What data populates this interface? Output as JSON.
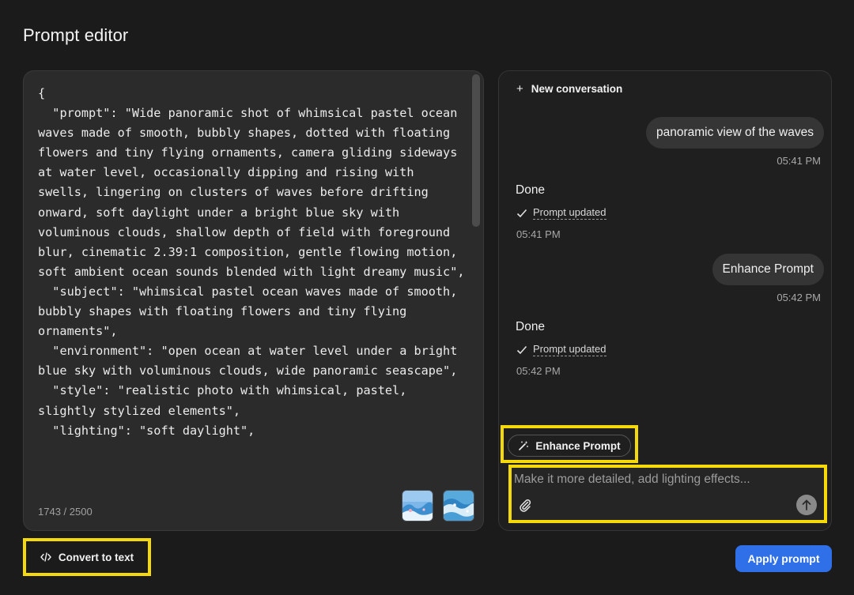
{
  "page": {
    "title": "Prompt editor"
  },
  "editor": {
    "content": "{\n  \"prompt\": \"Wide panoramic shot of whimsical pastel ocean waves made of smooth, bubbly shapes, dotted with floating flowers and tiny flying ornaments, camera gliding sideways at water level, occasionally dipping and rising with swells, lingering on clusters of waves before drifting onward, soft daylight under a bright blue sky with voluminous clouds, shallow depth of field with foreground blur, cinematic 2.39:1 composition, gentle flowing motion, soft ambient ocean sounds blended with light dreamy music\",\n  \"subject\": \"whimsical pastel ocean waves made of smooth, bubbly shapes with floating flowers and tiny flying ornaments\",\n  \"environment\": \"open ocean at water level under a bright blue sky with voluminous clouds, wide panoramic seascape\",\n  \"style\": \"realistic photo with whimsical, pastel, slightly stylized elements\",\n  \"lighting\": \"soft daylight\",",
    "char_count": "1743 / 2500"
  },
  "chat": {
    "new_conversation_label": "New conversation",
    "messages": [
      {
        "role": "user",
        "text": "panoramic view of the waves",
        "time": "05:41 PM"
      },
      {
        "role": "assistant",
        "status": "Done",
        "detail": "Prompt updated",
        "time": "05:41 PM"
      },
      {
        "role": "user",
        "text": "Enhance Prompt",
        "time": "05:42 PM"
      },
      {
        "role": "assistant",
        "status": "Done",
        "detail": "Prompt updated",
        "time": "05:42 PM"
      }
    ],
    "enhance_label": "Enhance Prompt",
    "input_placeholder": "Make it more detailed, add lighting effects..."
  },
  "actions": {
    "convert_label": "Convert to text",
    "apply_label": "Apply prompt"
  },
  "colors": {
    "accent": "#2f6fe8",
    "highlight": "#f5d90a",
    "background": "#1b1b1b"
  }
}
